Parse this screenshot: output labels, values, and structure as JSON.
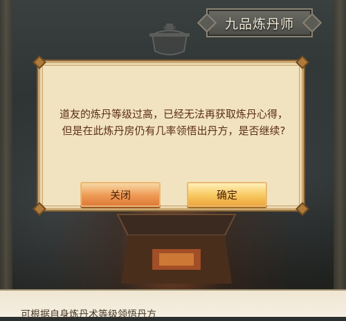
{
  "header": {
    "title": "九品炼丹师"
  },
  "dialog": {
    "message": "道友的炼丹等级过高，已经无法再获取炼丹心得，但是在此炼丹房仍有几率领悟出丹方，是否继续?",
    "close_label": "关闭",
    "confirm_label": "确定"
  },
  "footer": {
    "hint": "可根据自身炼丹术等级领悟丹方"
  },
  "colors": {
    "dialog_bg": "#f2e3c0",
    "dialog_text": "#5b2f14",
    "close_button": "#ee9a55",
    "confirm_button": "#f7c860"
  }
}
